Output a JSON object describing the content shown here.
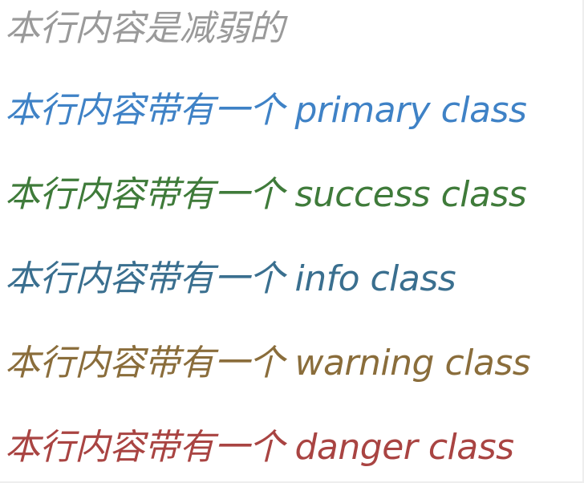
{
  "lines": [
    {
      "variant": "muted",
      "text": "本行内容是减弱的",
      "color": "#9a9a9a"
    },
    {
      "variant": "primary",
      "text": "本行内容带有一个 primary class",
      "color": "#3f82c6"
    },
    {
      "variant": "success",
      "text": "本行内容带有一个 success class",
      "color": "#3f7b3a"
    },
    {
      "variant": "info",
      "text": "本行内容带有一个 info class",
      "color": "#3a6f8f"
    },
    {
      "variant": "warning",
      "text": "本行内容带有一个 warning class",
      "color": "#8a6d3b"
    },
    {
      "variant": "danger",
      "text": "本行内容带有一个 danger class",
      "color": "#a94442"
    }
  ]
}
